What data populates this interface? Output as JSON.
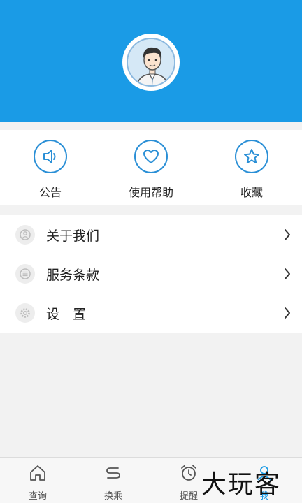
{
  "profile": {
    "avatar_icon": "user-avatar-icon"
  },
  "quick_actions": [
    {
      "label": "公告",
      "icon": "speaker-icon"
    },
    {
      "label": "使用帮助",
      "icon": "heart-icon"
    },
    {
      "label": "收藏",
      "icon": "star-icon"
    }
  ],
  "menu": [
    {
      "label": "关于我们",
      "icon": "about-icon"
    },
    {
      "label": "服务条款",
      "icon": "document-list-icon"
    },
    {
      "label": "设　置",
      "icon": "gear-icon"
    }
  ],
  "tabbar": [
    {
      "label": "查询",
      "icon": "home-icon"
    },
    {
      "label": "换乘",
      "icon": "transfer-icon"
    },
    {
      "label": "提醒",
      "icon": "alarm-clock-icon"
    },
    {
      "label": "我",
      "icon": "user-icon",
      "active": true
    }
  ],
  "watermark": "大玩客",
  "colors": {
    "primary": "#1a9be6",
    "icon_stroke": "#2a8fd6",
    "background": "#f2f2f2"
  }
}
